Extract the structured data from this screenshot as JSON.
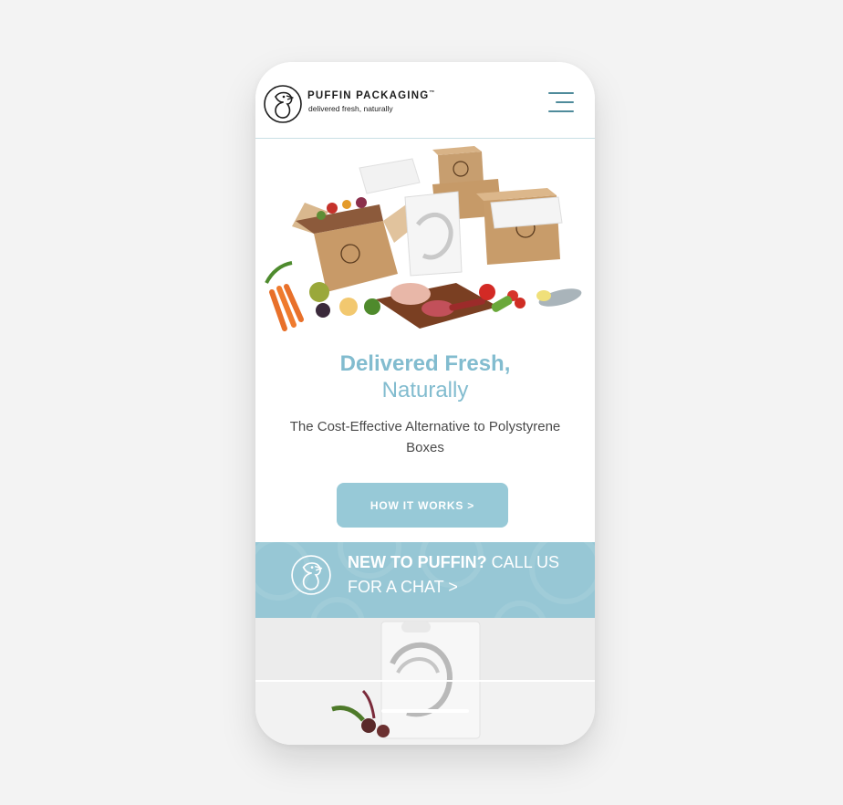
{
  "header": {
    "brand": "PUFFIN PACKAGING",
    "trademark": "™",
    "tagline": "delivered fresh, naturally",
    "logo_icon": "puffin-logo-icon",
    "menu_icon": "hamburger-menu-icon"
  },
  "hero": {
    "image": "hero-boxes-and-groceries-image",
    "title_line1": "Delivered Fresh,",
    "title_line2": "Naturally",
    "subtitle": "The Cost-Effective Alternative to Polystyrene Boxes",
    "cta_label": "HOW IT WORKS >"
  },
  "banner": {
    "icon": "puffin-logo-icon",
    "text_bold": "NEW TO PUFFIN?",
    "text_rest": " CALL US FOR A CHAT >"
  },
  "product": {
    "image": "puffin-bag-with-beetroot-image"
  },
  "colors": {
    "accent": "#82bccf",
    "button": "#97c9d7",
    "banner": "#97c7d5",
    "menu_lines": "#4f8b9b"
  }
}
